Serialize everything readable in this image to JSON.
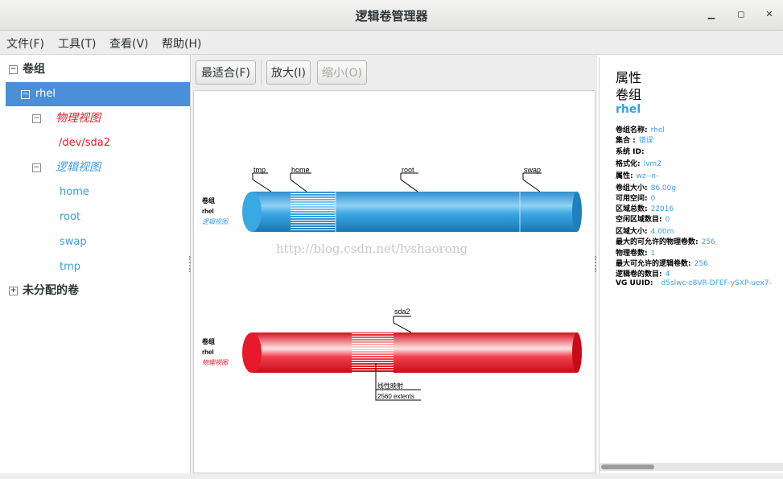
{
  "window": {
    "title": "逻辑卷管理器",
    "minimize": "▁",
    "maximize": "◻",
    "close": "✕"
  },
  "menu": [
    "文件(F)",
    "工具(T)",
    "查看(V)",
    "帮助(H)"
  ],
  "tree": {
    "group_label": "卷组",
    "vg_name": "rhel",
    "physical_view": "物理视图",
    "pv": "/dev/sda2",
    "logical_view": "逻辑视图",
    "lvs": [
      "home",
      "root",
      "swap",
      "tmp"
    ],
    "unallocated": "未分配的卷"
  },
  "toolbar": {
    "fit": "最适合(F)",
    "zoom_in": "放大(I)",
    "zoom_out": "缩小(O)"
  },
  "logical_diagram": {
    "caption": [
      "卷组",
      "rhel",
      "逻辑视图"
    ],
    "labels": [
      "tmp",
      "home",
      "root",
      "swap"
    ]
  },
  "physical_diagram": {
    "caption": [
      "卷组",
      "rhel",
      "物理视图"
    ],
    "label": "sda2",
    "mapping": "线性映射",
    "extents": "2560 extents"
  },
  "watermark": "http://blog.csdn.net/lvshaorong",
  "properties": {
    "heading": "属性",
    "subheading": "卷组",
    "name": "rhel",
    "rows": [
      {
        "k": "卷组名称:",
        "v": "rhel"
      },
      {
        "k": "集合 :",
        "v": "错误"
      },
      {
        "k": "系统 ID:",
        "v": ""
      },
      {
        "k": "格式化:",
        "v": "lvm2"
      },
      {
        "k": "属性:",
        "v": "wz--n-"
      },
      {
        "k": "卷组大小:",
        "v": "86.00g"
      },
      {
        "k": "可用空间:",
        "v": "0"
      },
      {
        "k": "区域总数:",
        "v": "22016"
      },
      {
        "k": "空闲区域数目:",
        "v": "0"
      },
      {
        "k": "区域大小:",
        "v": "4.00m"
      },
      {
        "k": "最大的可允许的物理卷数:",
        "v": "256"
      },
      {
        "k": "物理卷数:",
        "v": "1"
      },
      {
        "k": "最大可允许的逻辑卷数:",
        "v": "256"
      },
      {
        "k": "逻辑卷的数目:",
        "v": "4"
      },
      {
        "k": "VG UUID:",
        "v": "d5slwc-c8VR-DFEF-ySXP-uex7-"
      }
    ]
  },
  "colors": {
    "logical": "#4ab0e4",
    "physical": "#e8192c",
    "accent": "#3b9ee0",
    "selection": "#4a90d9"
  }
}
